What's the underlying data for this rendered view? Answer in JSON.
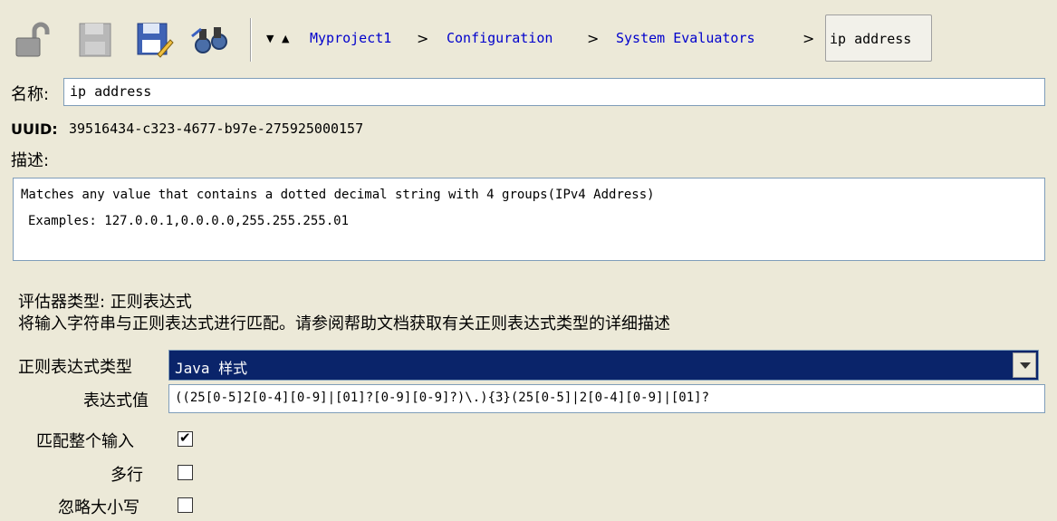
{
  "toolbar": {
    "icons": [
      "unlock-icon",
      "save-disabled-icon",
      "save-as-icon",
      "search-references-icon"
    ],
    "nav_down": "▼",
    "nav_up": "▲",
    "breadcrumbs": [
      "Myproject1",
      "Configuration",
      "System Evaluators"
    ],
    "crumb_separator": ">",
    "current": "ip address"
  },
  "name": {
    "label": "名称:",
    "value": "ip address"
  },
  "uuid": {
    "label": "UUID:",
    "value": "39516434-c323-4677-b97e-275925000157"
  },
  "description": {
    "label": "描述:",
    "line1": "Matches any value that contains a dotted decimal string with 4 groups(IPv4 Address)",
    "line2": "Examples: 127.0.0.1,0.0.0.0,255.255.255.01"
  },
  "evaluator": {
    "type_line": "评估器类型: 正则表达式",
    "help_line": "将输入字符串与正则表达式进行匹配。请参阅帮助文档获取有关正则表达式类型的详细描述"
  },
  "regex_type": {
    "label": "正则表达式类型",
    "value": "Java 样式"
  },
  "expression": {
    "label": "表达式值",
    "value": "((25[0-5]2[0-4][0-9]|[01]?[0-9][0-9]?)\\.){3}(25[0-5]|2[0-4][0-9]|[01]?"
  },
  "options": {
    "match_whole": {
      "label": "匹配整个输入",
      "checked": true
    },
    "multiline": {
      "label": "多行",
      "checked": false
    },
    "ignore_case": {
      "label": "忽略大小写",
      "checked": false
    }
  }
}
